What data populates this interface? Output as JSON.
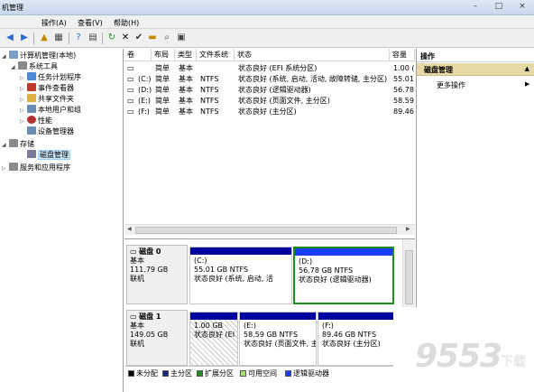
{
  "window": {
    "title": "机管理"
  },
  "menu": [
    "操作(A)",
    "查看(V)",
    "帮助(H)"
  ],
  "tree": [
    {
      "label": "计算机管理(本地)",
      "icon": "computer-icon"
    },
    {
      "label": "系统工具",
      "icon": "tools-icon"
    },
    {
      "label": "任务计划程序",
      "icon": "clock-icon"
    },
    {
      "label": "事件查看器",
      "icon": "event-viewer-icon"
    },
    {
      "label": "共享文件夹",
      "icon": "shared-folder-icon"
    },
    {
      "label": "本地用户和组",
      "icon": "users-icon"
    },
    {
      "label": "性能",
      "icon": "performance-icon"
    },
    {
      "label": "设备管理器",
      "icon": "device-manager-icon"
    },
    {
      "label": "存储",
      "icon": "storage-icon"
    },
    {
      "label": "磁盘管理",
      "icon": "disk-management-icon"
    },
    {
      "label": "服务和应用程序",
      "icon": "services-icon"
    }
  ],
  "volumes": {
    "columns": [
      "卷",
      "布局",
      "类型",
      "文件系统",
      "状态",
      "容量"
    ],
    "rows": [
      [
        "",
        "简单",
        "基本",
        "",
        "状态良好 (EFI 系统分区)",
        "1.00 ("
      ],
      [
        "(C:)",
        "简单",
        "基本",
        "NTFS",
        "状态良好 (系统, 启动, 活动, 故障转储, 主分区)",
        "55.01"
      ],
      [
        "(D:)",
        "简单",
        "基本",
        "NTFS",
        "状态良好 (逻辑驱动器)",
        "56.78"
      ],
      [
        "(E:)",
        "简单",
        "基本",
        "NTFS",
        "状态良好 (页面文件, 主分区)",
        "58.59"
      ],
      [
        "(F:)",
        "简单",
        "基本",
        "NTFS",
        "状态良好 (主分区)",
        "89.46"
      ]
    ]
  },
  "disks": [
    {
      "name": "磁盘 0",
      "type": "基本",
      "size": "111.79 GB",
      "status": "联机",
      "partitions": [
        {
          "name": "(C:)",
          "size": "55.01 GB NTFS",
          "status": "状态良好 (系统, 启动, 活"
        },
        {
          "name": "(D:)",
          "size": "56.78 GB NTFS",
          "status": "状态良好 (逻辑驱动器)"
        }
      ]
    },
    {
      "name": "磁盘 1",
      "type": "基本",
      "size": "149.05 GB",
      "status": "联机",
      "partitions": [
        {
          "name": "",
          "size": "1.00 GB",
          "status": "状态良好 (EI"
        },
        {
          "name": "(E:)",
          "size": "58.59 GB NTFS",
          "status": "状态良好 (页面文件, 主"
        },
        {
          "name": "(F:)",
          "size": "89.46 GB NTFS",
          "status": "状态良好 (主分区)"
        }
      ]
    }
  ],
  "legend": [
    {
      "label": "未分配",
      "color": "#000000"
    },
    {
      "label": "主分区",
      "color": "#1a237e"
    },
    {
      "label": "扩展分区",
      "color": "#1e8c1e"
    },
    {
      "label": "可用空间",
      "color": "#a5e06a"
    },
    {
      "label": "逻辑驱动器",
      "color": "#1a3cff"
    }
  ],
  "actions": {
    "header": "操作",
    "section": "磁盘管理",
    "more": "更多操作"
  },
  "watermark": {
    "text": "9553",
    "sub": "下载"
  }
}
